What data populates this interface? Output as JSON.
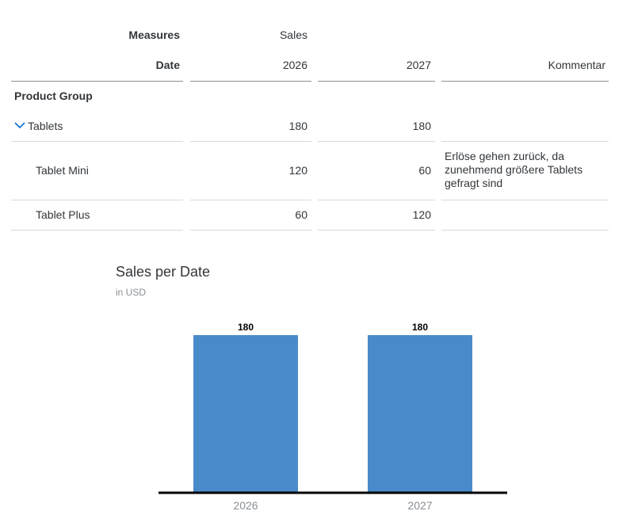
{
  "table": {
    "header_measures_label": "Measures",
    "header_measures_value": "Sales",
    "header_date_label": "Date",
    "columns": [
      "2026",
      "2027",
      "Kommentar"
    ],
    "row_dimension_label": "Product Group",
    "rows": [
      {
        "label": "Tablets",
        "values": [
          "180",
          "180"
        ],
        "comment": "",
        "expanded": true
      },
      {
        "label": "Tablet Mini",
        "values": [
          "120",
          "60"
        ],
        "comment": "Erlöse gehen zurück, da zunehmend größere Tablets gefragt sind"
      },
      {
        "label": "Tablet Plus",
        "values": [
          "60",
          "120"
        ],
        "comment": ""
      }
    ]
  },
  "chart_data": {
    "type": "bar",
    "title": "Sales per Date",
    "subtitle": "in USD",
    "categories": [
      "2026",
      "2027"
    ],
    "values": [
      180,
      180
    ],
    "ylim": [
      0,
      180
    ],
    "grid": false,
    "color": "#498bca"
  },
  "colors": {
    "bar": "#498bca",
    "axis": "#000000",
    "accent": "#0a6ed1"
  }
}
